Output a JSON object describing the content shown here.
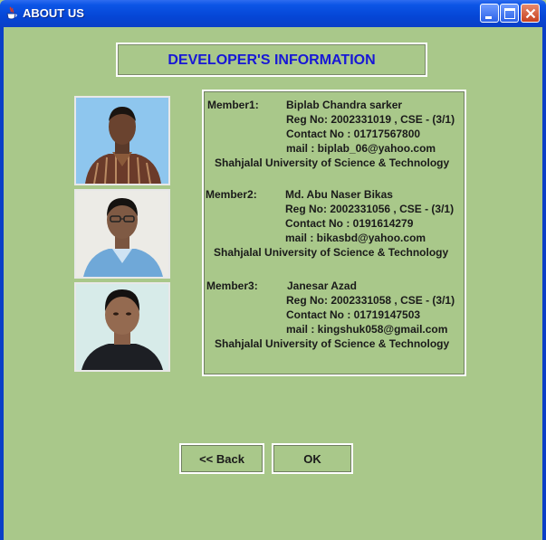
{
  "window": {
    "title": "ABOUT US",
    "icon": "java-cup-icon",
    "controls": [
      "minimize-icon",
      "maximize-icon",
      "close-icon"
    ]
  },
  "heading": "DEVELOPER'S INFORMATION",
  "members": [
    {
      "label": "Member1:",
      "name": "Biplab Chandra sarker",
      "reg": "Reg No: 2002331019 , CSE - (3/1)",
      "contact": "Contact No : 01717567800",
      "mail": "mail : biplab_06@yahoo.com",
      "university": "Shahjalal University of Science & Technology"
    },
    {
      "label": "Member2:",
      "name": "Md. Abu Naser Bikas",
      "reg": "Reg No: 2002331056 , CSE - (3/1)",
      "contact": "Contact No : 0191614279",
      "mail": "mail : bikasbd@yahoo.com",
      "university": "Shahjalal University of Science & Technology"
    },
    {
      "label": "Member3:",
      "name": "Janesar Azad",
      "reg": "Reg No: 2002331058 , CSE - (3/1)",
      "contact": "Contact No : 01719147503",
      "mail": "mail : kingshuk058@gmail.com",
      "university": "Shahjalal University of Science & Technology"
    }
  ],
  "buttons": {
    "back": "<< Back",
    "ok": "OK"
  },
  "colors": {
    "background": "#a9c88a",
    "heading": "#1717d6",
    "titlebar": "#0546d6"
  }
}
